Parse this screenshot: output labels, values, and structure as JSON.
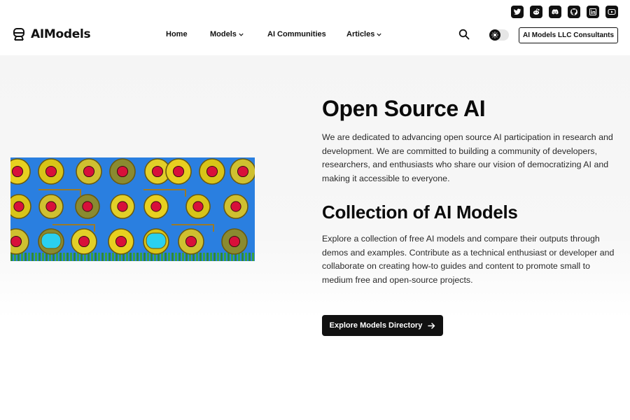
{
  "social": {
    "icons": [
      "twitter-icon",
      "reddit-icon",
      "discord-icon",
      "github-icon",
      "linkedin-icon",
      "youtube-icon"
    ]
  },
  "header": {
    "logo_text": "AIModels",
    "nav": [
      {
        "label": "Home"
      },
      {
        "label": "Models",
        "has_dropdown": true
      },
      {
        "label": "AI Communities"
      },
      {
        "label": "Articles",
        "has_dropdown": true
      }
    ],
    "consult_label": "AI Models LLC Consultants"
  },
  "hero": {
    "title": "Open Source AI",
    "intro": "We are dedicated to advancing open source AI participation in research and development. We are committed to building a community of developers, researchers, and enthusiasts who share our vision of democratizing AI and making it accessible to everyone.",
    "collection_title": "Collection of AI Models",
    "collection_text": "Explore a collection of free AI models and compare their outputs through demos and examples. Contribute as a technical enthusiast or developer and collaborate on creating how-to guides and content to promote small to medium free and open-source projects.",
    "cta_label": "Explore Models Directory"
  },
  "colors": {
    "text": "#111111",
    "hero_bg": "#f5f5f5",
    "button_bg": "#111111",
    "art_blue": "#2a7fe0",
    "art_yellow": "#e8d020",
    "art_red": "#d8103a"
  }
}
